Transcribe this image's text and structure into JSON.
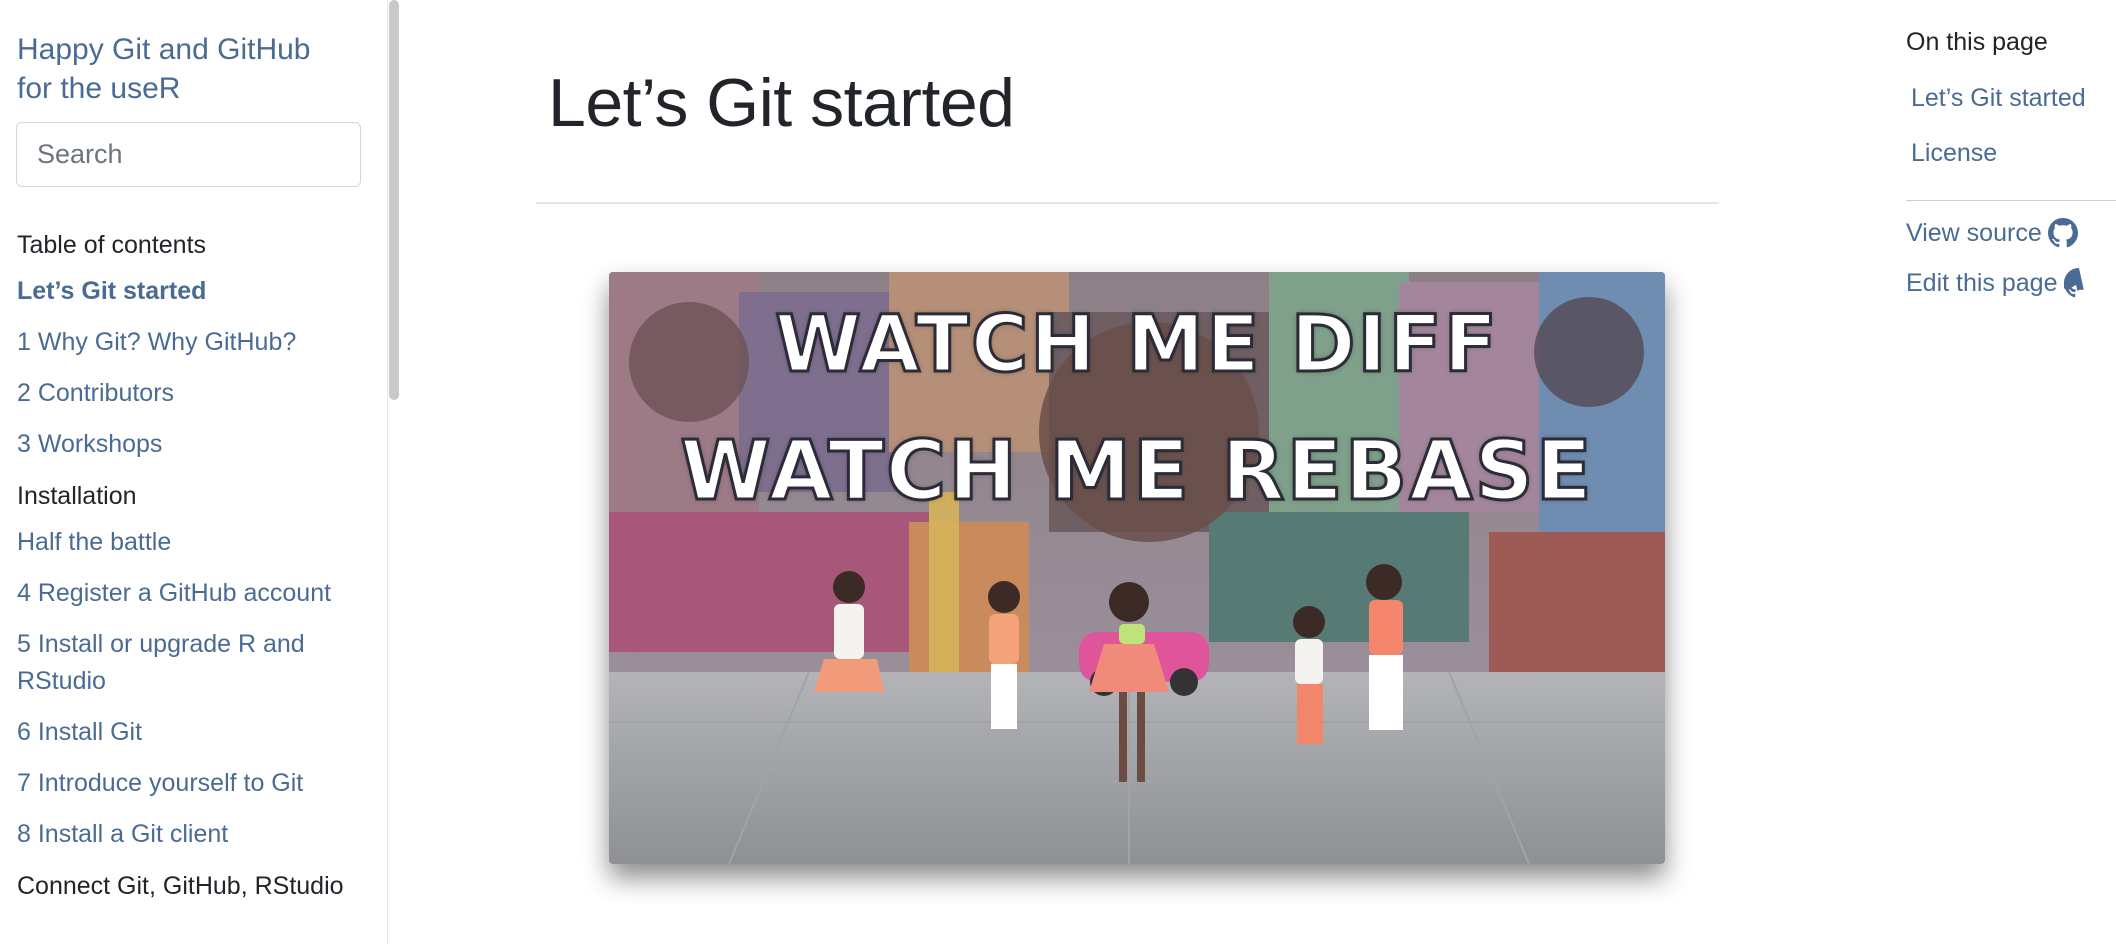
{
  "book": {
    "title": "Happy Git and GitHub for the useR",
    "search_placeholder": "Search"
  },
  "toc": {
    "heading": "Table of contents",
    "items": [
      {
        "label": "Let’s Git started",
        "active": true
      },
      {
        "label": "1 Why Git? Why GitHub?"
      },
      {
        "label": "2 Contributors"
      },
      {
        "label": "3 Workshops"
      }
    ],
    "installation": {
      "heading": "Installation",
      "items": [
        {
          "label": "Half the battle"
        },
        {
          "label": "4 Register a GitHub account"
        },
        {
          "label": "5 Install or upgrade R and RStudio"
        },
        {
          "label": "6 Install Git"
        },
        {
          "label": "7 Introduce yourself to Git"
        },
        {
          "label": "8 Install a Git client"
        }
      ]
    },
    "connect": {
      "heading": "Connect Git, GitHub, RStudio"
    }
  },
  "main": {
    "title": "Let’s Git started",
    "hero": {
      "line1": "WATCH ME DIFF",
      "line2": "WATCH ME REBASE"
    }
  },
  "on_this_page": {
    "heading": "On this page",
    "links": [
      "Let’s Git started",
      "License"
    ],
    "view_source": "View source",
    "edit_page": "Edit this page"
  },
  "colors": {
    "link": "#4a6b93",
    "text": "#212529"
  },
  "icons": {
    "github": "github-icon"
  }
}
